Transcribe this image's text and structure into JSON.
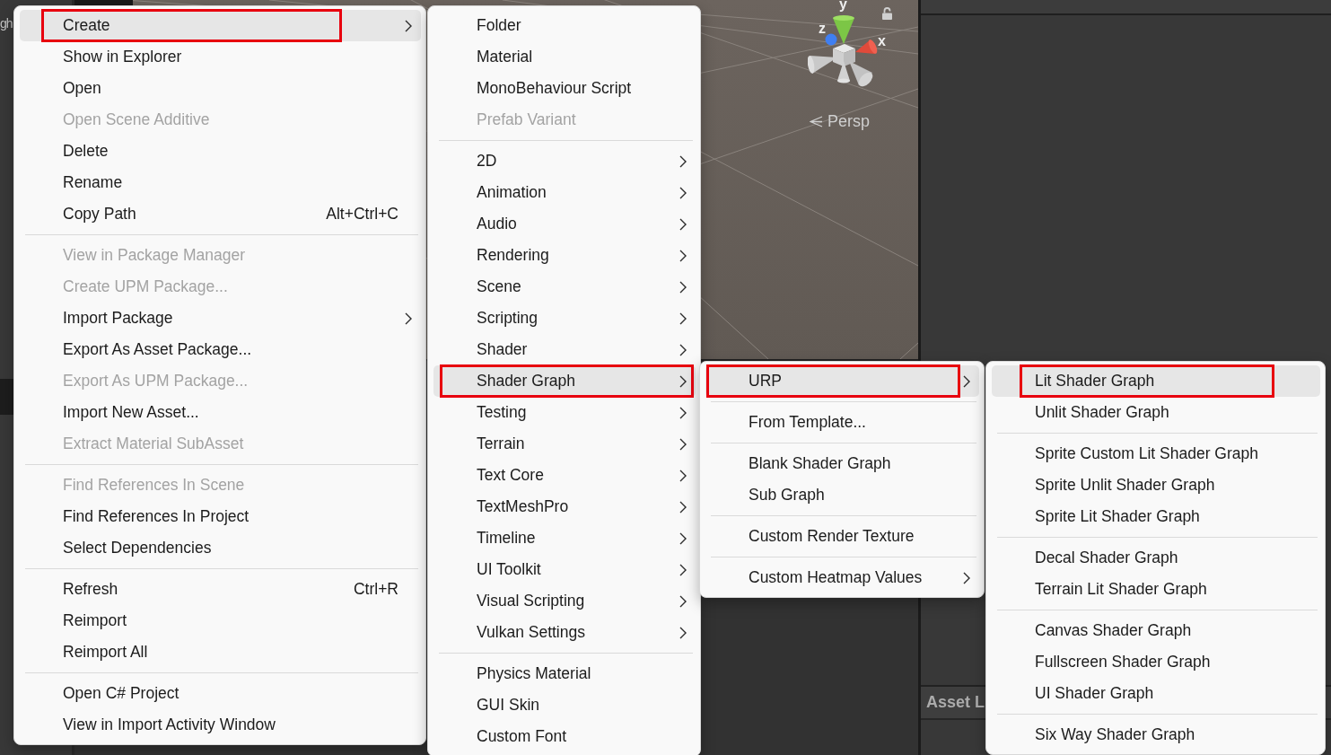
{
  "editor": {
    "side_panel": {
      "label": "gh"
    },
    "scene_view": {
      "axis_labels": [
        "y",
        "z",
        "x"
      ],
      "projection_label": "Persp"
    },
    "asset_panel": {
      "title": "Asset L"
    }
  },
  "menus": [
    {
      "items": [
        {
          "kind": "item",
          "label": "Create",
          "selected": true,
          "disabled": false,
          "submenu": true,
          "annotated": true
        },
        {
          "kind": "item",
          "label": "Show in Explorer",
          "selected": false,
          "disabled": false,
          "submenu": false,
          "annotated": false
        },
        {
          "kind": "item",
          "label": "Open",
          "selected": false,
          "disabled": false,
          "submenu": false,
          "annotated": false
        },
        {
          "kind": "item",
          "label": "Open Scene Additive",
          "selected": false,
          "disabled": true,
          "submenu": false,
          "annotated": false
        },
        {
          "kind": "item",
          "label": "Delete",
          "selected": false,
          "disabled": false,
          "submenu": false,
          "annotated": false
        },
        {
          "kind": "item",
          "label": "Rename",
          "selected": false,
          "disabled": false,
          "submenu": false,
          "annotated": false
        },
        {
          "kind": "item",
          "label": "Copy Path",
          "shortcut": "Alt+Ctrl+C",
          "selected": false,
          "disabled": false,
          "submenu": false,
          "annotated": false
        },
        {
          "kind": "separator"
        },
        {
          "kind": "item",
          "label": "View in Package Manager",
          "selected": false,
          "disabled": true,
          "submenu": false,
          "annotated": false
        },
        {
          "kind": "item",
          "label": "Create UPM Package...",
          "selected": false,
          "disabled": true,
          "submenu": false,
          "annotated": false
        },
        {
          "kind": "item",
          "label": "Import Package",
          "selected": false,
          "disabled": false,
          "submenu": true,
          "annotated": false
        },
        {
          "kind": "item",
          "label": "Export As Asset Package...",
          "selected": false,
          "disabled": false,
          "submenu": false,
          "annotated": false
        },
        {
          "kind": "item",
          "label": "Export As UPM Package...",
          "selected": false,
          "disabled": true,
          "submenu": false,
          "annotated": false
        },
        {
          "kind": "item",
          "label": "Import New Asset...",
          "selected": false,
          "disabled": false,
          "submenu": false,
          "annotated": false
        },
        {
          "kind": "item",
          "label": "Extract Material SubAsset",
          "selected": false,
          "disabled": true,
          "submenu": false,
          "annotated": false
        },
        {
          "kind": "separator"
        },
        {
          "kind": "item",
          "label": "Find References In Scene",
          "selected": false,
          "disabled": true,
          "submenu": false,
          "annotated": false
        },
        {
          "kind": "item",
          "label": "Find References In Project",
          "selected": false,
          "disabled": false,
          "submenu": false,
          "annotated": false
        },
        {
          "kind": "item",
          "label": "Select Dependencies",
          "selected": false,
          "disabled": false,
          "submenu": false,
          "annotated": false
        },
        {
          "kind": "separator"
        },
        {
          "kind": "item",
          "label": "Refresh",
          "shortcut": "Ctrl+R",
          "selected": false,
          "disabled": false,
          "submenu": false,
          "annotated": false
        },
        {
          "kind": "item",
          "label": "Reimport",
          "selected": false,
          "disabled": false,
          "submenu": false,
          "annotated": false
        },
        {
          "kind": "item",
          "label": "Reimport All",
          "selected": false,
          "disabled": false,
          "submenu": false,
          "annotated": false
        },
        {
          "kind": "separator"
        },
        {
          "kind": "item",
          "label": "Open C# Project",
          "selected": false,
          "disabled": false,
          "submenu": false,
          "annotated": false
        },
        {
          "kind": "item",
          "label": "View in Import Activity Window",
          "selected": false,
          "disabled": false,
          "submenu": false,
          "annotated": false
        }
      ]
    },
    {
      "items": [
        {
          "kind": "item",
          "label": "Folder",
          "selected": false,
          "disabled": false,
          "submenu": false,
          "annotated": false
        },
        {
          "kind": "item",
          "label": "Material",
          "selected": false,
          "disabled": false,
          "submenu": false,
          "annotated": false
        },
        {
          "kind": "item",
          "label": "MonoBehaviour Script",
          "selected": false,
          "disabled": false,
          "submenu": false,
          "annotated": false
        },
        {
          "kind": "item",
          "label": "Prefab Variant",
          "selected": false,
          "disabled": true,
          "submenu": false,
          "annotated": false
        },
        {
          "kind": "separator"
        },
        {
          "kind": "item",
          "label": "2D",
          "selected": false,
          "disabled": false,
          "submenu": true,
          "annotated": false
        },
        {
          "kind": "item",
          "label": "Animation",
          "selected": false,
          "disabled": false,
          "submenu": true,
          "annotated": false
        },
        {
          "kind": "item",
          "label": "Audio",
          "selected": false,
          "disabled": false,
          "submenu": true,
          "annotated": false
        },
        {
          "kind": "item",
          "label": "Rendering",
          "selected": false,
          "disabled": false,
          "submenu": true,
          "annotated": false
        },
        {
          "kind": "item",
          "label": "Scene",
          "selected": false,
          "disabled": false,
          "submenu": true,
          "annotated": false
        },
        {
          "kind": "item",
          "label": "Scripting",
          "selected": false,
          "disabled": false,
          "submenu": true,
          "annotated": false
        },
        {
          "kind": "item",
          "label": "Shader",
          "selected": false,
          "disabled": false,
          "submenu": true,
          "annotated": false
        },
        {
          "kind": "item",
          "label": "Shader Graph",
          "selected": true,
          "disabled": false,
          "submenu": true,
          "annotated": true
        },
        {
          "kind": "item",
          "label": "Testing",
          "selected": false,
          "disabled": false,
          "submenu": true,
          "annotated": false
        },
        {
          "kind": "item",
          "label": "Terrain",
          "selected": false,
          "disabled": false,
          "submenu": true,
          "annotated": false
        },
        {
          "kind": "item",
          "label": "Text Core",
          "selected": false,
          "disabled": false,
          "submenu": true,
          "annotated": false
        },
        {
          "kind": "item",
          "label": "TextMeshPro",
          "selected": false,
          "disabled": false,
          "submenu": true,
          "annotated": false
        },
        {
          "kind": "item",
          "label": "Timeline",
          "selected": false,
          "disabled": false,
          "submenu": true,
          "annotated": false
        },
        {
          "kind": "item",
          "label": "UI Toolkit",
          "selected": false,
          "disabled": false,
          "submenu": true,
          "annotated": false
        },
        {
          "kind": "item",
          "label": "Visual Scripting",
          "selected": false,
          "disabled": false,
          "submenu": true,
          "annotated": false
        },
        {
          "kind": "item",
          "label": "Vulkan Settings",
          "selected": false,
          "disabled": false,
          "submenu": true,
          "annotated": false
        },
        {
          "kind": "separator"
        },
        {
          "kind": "item",
          "label": "Physics Material",
          "selected": false,
          "disabled": false,
          "submenu": false,
          "annotated": false
        },
        {
          "kind": "item",
          "label": "GUI Skin",
          "selected": false,
          "disabled": false,
          "submenu": false,
          "annotated": false
        },
        {
          "kind": "item",
          "label": "Custom Font",
          "selected": false,
          "disabled": false,
          "submenu": false,
          "annotated": false
        }
      ]
    },
    {
      "items": [
        {
          "kind": "item",
          "label": "URP",
          "selected": true,
          "disabled": false,
          "submenu": true,
          "annotated": true
        },
        {
          "kind": "separator"
        },
        {
          "kind": "item",
          "label": "From Template...",
          "selected": false,
          "disabled": false,
          "submenu": false,
          "annotated": false
        },
        {
          "kind": "separator"
        },
        {
          "kind": "item",
          "label": "Blank Shader Graph",
          "selected": false,
          "disabled": false,
          "submenu": false,
          "annotated": false
        },
        {
          "kind": "item",
          "label": "Sub Graph",
          "selected": false,
          "disabled": false,
          "submenu": false,
          "annotated": false
        },
        {
          "kind": "separator"
        },
        {
          "kind": "item",
          "label": "Custom Render Texture",
          "selected": false,
          "disabled": false,
          "submenu": false,
          "annotated": false
        },
        {
          "kind": "separator"
        },
        {
          "kind": "item",
          "label": "Custom Heatmap Values",
          "selected": false,
          "disabled": false,
          "submenu": true,
          "annotated": false
        }
      ]
    },
    {
      "items": [
        {
          "kind": "item",
          "label": "Lit Shader Graph",
          "selected": true,
          "disabled": false,
          "submenu": false,
          "annotated": true
        },
        {
          "kind": "item",
          "label": "Unlit Shader Graph",
          "selected": false,
          "disabled": false,
          "submenu": false,
          "annotated": false
        },
        {
          "kind": "separator"
        },
        {
          "kind": "item",
          "label": "Sprite Custom Lit Shader Graph",
          "selected": false,
          "disabled": false,
          "submenu": false,
          "annotated": false
        },
        {
          "kind": "item",
          "label": "Sprite Unlit Shader Graph",
          "selected": false,
          "disabled": false,
          "submenu": false,
          "annotated": false
        },
        {
          "kind": "item",
          "label": "Sprite Lit Shader Graph",
          "selected": false,
          "disabled": false,
          "submenu": false,
          "annotated": false
        },
        {
          "kind": "separator"
        },
        {
          "kind": "item",
          "label": "Decal Shader Graph",
          "selected": false,
          "disabled": false,
          "submenu": false,
          "annotated": false
        },
        {
          "kind": "item",
          "label": "Terrain Lit Shader Graph",
          "selected": false,
          "disabled": false,
          "submenu": false,
          "annotated": false
        },
        {
          "kind": "separator"
        },
        {
          "kind": "item",
          "label": "Canvas Shader Graph",
          "selected": false,
          "disabled": false,
          "submenu": false,
          "annotated": false
        },
        {
          "kind": "item",
          "label": "Fullscreen Shader Graph",
          "selected": false,
          "disabled": false,
          "submenu": false,
          "annotated": false
        },
        {
          "kind": "item",
          "label": "UI Shader Graph",
          "selected": false,
          "disabled": false,
          "submenu": false,
          "annotated": false
        },
        {
          "kind": "separator"
        },
        {
          "kind": "item",
          "label": "Six Way Shader Graph",
          "selected": false,
          "disabled": false,
          "submenu": false,
          "annotated": false
        }
      ]
    }
  ]
}
